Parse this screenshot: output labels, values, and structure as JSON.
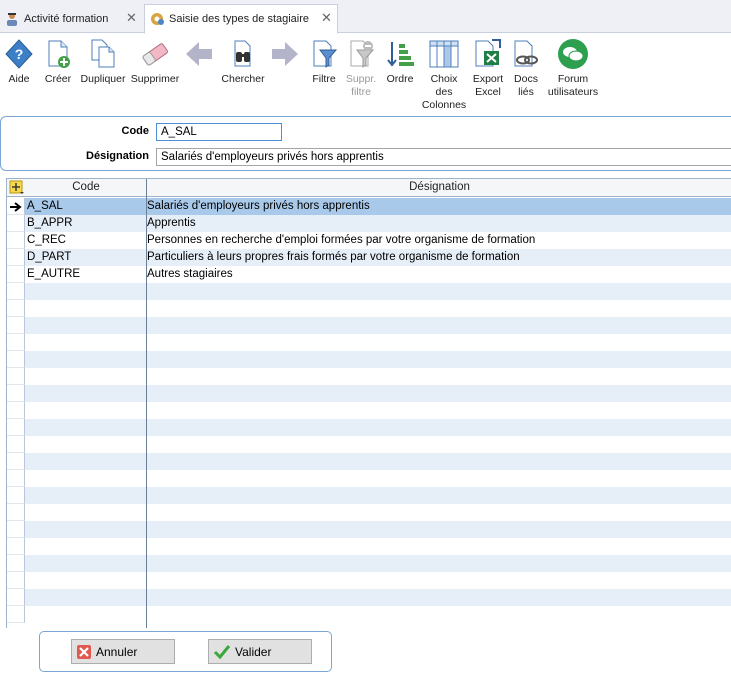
{
  "tabs": [
    {
      "label": "Activité formation",
      "icon": "training-icon"
    },
    {
      "label": "Saisie des types de stagiaire",
      "icon": "settings-gear-icon"
    }
  ],
  "toolbar": {
    "aide": "Aide",
    "creer": "Créer",
    "dupliquer": "Dupliquer",
    "supprimer": "Supprimer",
    "chercher": "Chercher",
    "filtre": "Filtre",
    "suppr_filtre_1": "Suppr.",
    "suppr_filtre_2": "filtre",
    "ordre": "Ordre",
    "choix_1": "Choix",
    "choix_2": "des",
    "choix_3": "Colonnes",
    "export_1": "Export",
    "export_2": "Excel",
    "docs_1": "Docs",
    "docs_2": "liés",
    "forum_1": "Forum",
    "forum_2": "utilisateurs"
  },
  "form": {
    "code_label": "Code",
    "code_value": "A_SAL",
    "designation_label": "Désignation",
    "designation_value": "Salariés d'employeurs privés hors apprentis"
  },
  "grid": {
    "columns": [
      "Code",
      "Désignation"
    ],
    "rows": [
      {
        "code": "A_SAL",
        "designation": "Salariés d'employeurs privés hors apprentis"
      },
      {
        "code": "B_APPR",
        "designation": "Apprentis"
      },
      {
        "code": "C_REC",
        "designation": "Personnes en recherche d'emploi formées par votre organisme de formation"
      },
      {
        "code": "D_PART",
        "designation": "Particuliers à leurs propres frais formés par votre organisme de formation"
      },
      {
        "code": "E_AUTRE",
        "designation": "Autres stagiaires"
      }
    ],
    "selected_index": 0
  },
  "buttons": {
    "annuler": "Annuler",
    "valider": "Valider"
  },
  "colors": {
    "accent": "#4d8fd6",
    "selected_row": "#a9c9ea",
    "alt_row": "#e6eef7",
    "frame": "#7aa6d6"
  }
}
